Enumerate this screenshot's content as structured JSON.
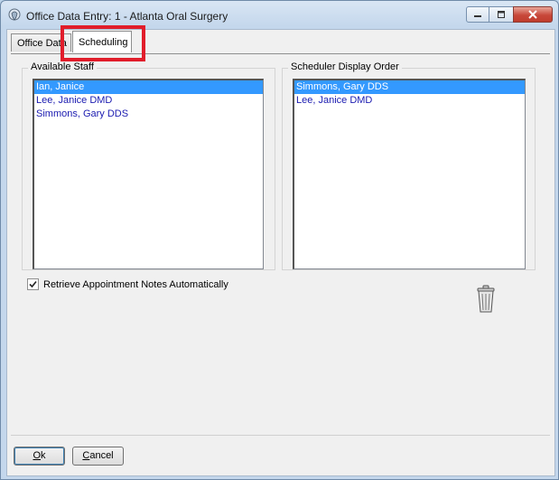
{
  "window": {
    "title": "Office Data Entry: 1 - Atlanta Oral Surgery",
    "controls": {
      "minimize": "minimize-icon",
      "maximize": "maximize-icon",
      "close": "close-icon"
    }
  },
  "tabs": {
    "office_data": "Office Data",
    "scheduling": "Scheduling"
  },
  "available_staff": {
    "label": "Available Staff",
    "items": [
      "Ian, Janice",
      "Lee, Janice DMD",
      "Simmons, Gary DDS"
    ],
    "selected_index": 0
  },
  "display_order": {
    "label": "Scheduler Display Order",
    "items": [
      "Simmons, Gary DDS",
      "Lee, Janice DMD"
    ],
    "selected_index": 0
  },
  "options": {
    "retrieve_notes_label": "Retrieve Appointment Notes Automatically",
    "retrieve_notes_checked": true
  },
  "buttons": {
    "ok_first": "O",
    "ok_rest": "k",
    "cancel_first": "C",
    "cancel_rest": "ancel"
  },
  "colors": {
    "highlight_box": "#e11d2b",
    "selection": "#3399ff",
    "list_text": "#1a1ab0"
  }
}
